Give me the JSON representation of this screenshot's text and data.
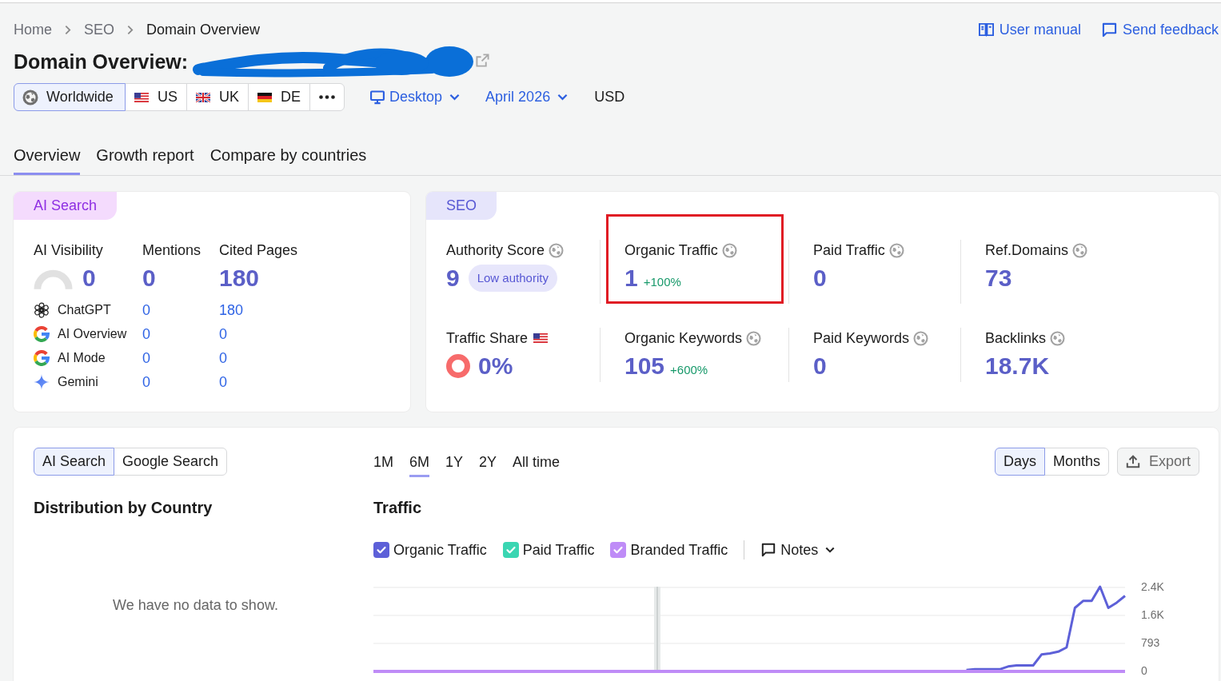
{
  "header": {
    "breadcrumbs": [
      {
        "label": "Home",
        "current": false
      },
      {
        "label": "SEO",
        "current": false
      },
      {
        "label": "Domain Overview",
        "current": true
      }
    ],
    "links": [
      {
        "label": "User manual",
        "kind": "manual"
      },
      {
        "label": "Send feedback",
        "kind": "feedback"
      }
    ],
    "title": "Domain Overview:",
    "domain_redacted": true,
    "databases": [
      {
        "label": "Worldwide",
        "kind": "globe",
        "selected": true
      },
      {
        "label": "US",
        "kind": "us",
        "selected": false
      },
      {
        "label": "UK",
        "kind": "uk",
        "selected": false
      },
      {
        "label": "DE",
        "kind": "de",
        "selected": false
      },
      {
        "kind": "more",
        "selected": false
      }
    ],
    "device": "Desktop",
    "date": "April 2026",
    "currency": "USD"
  },
  "tabs": [
    {
      "label": "Overview",
      "selected": true
    },
    {
      "label": "Growth report",
      "selected": false
    },
    {
      "label": "Compare by countries",
      "selected": false
    }
  ],
  "ai_search_card": {
    "tag": "AI Search",
    "metrics": [
      {
        "label": "AI Visibility",
        "value": "0",
        "kind": "gauge"
      },
      {
        "label": "Mentions",
        "value": "0",
        "kind": "plain"
      },
      {
        "label": "Cited Pages",
        "value": "180",
        "kind": "plain"
      }
    ],
    "platforms": [
      {
        "name": "ChatGPT",
        "kind": "chatgpt",
        "mentions": "0",
        "cited_pages": "180"
      },
      {
        "name": "AI Overview",
        "kind": "google",
        "mentions": "0",
        "cited_pages": "0"
      },
      {
        "name": "AI Mode",
        "kind": "google",
        "mentions": "0",
        "cited_pages": "0"
      },
      {
        "name": "Gemini",
        "kind": "gemini",
        "mentions": "0",
        "cited_pages": "0"
      }
    ]
  },
  "seo_card": {
    "tag": "SEO",
    "metrics": [
      {
        "label": "Authority Score",
        "label_icon": {
          "kind": "globe"
        },
        "value": "9",
        "kind": "badge",
        "badge": "Low authority",
        "highlighted": false
      },
      {
        "label": "Organic Traffic",
        "label_icon": {
          "kind": "globe"
        },
        "value": "1",
        "kind": "change",
        "change": "+100%",
        "highlighted": true
      },
      {
        "label": "Paid Traffic",
        "label_icon": {
          "kind": "globe"
        },
        "value": "0",
        "kind": "plain",
        "highlighted": false
      },
      {
        "label": "Ref.Domains",
        "label_icon": {
          "kind": "globe"
        },
        "value": "73",
        "kind": "plain",
        "highlighted": false
      },
      {
        "label": "Traffic Share",
        "label_icon": {
          "kind": "us_flag"
        },
        "value": "0%",
        "kind": "ring",
        "highlighted": false
      },
      {
        "label": "Organic Keywords",
        "label_icon": {
          "kind": "globe"
        },
        "value": "105",
        "kind": "change",
        "change": "+600%",
        "highlighted": false
      },
      {
        "label": "Paid Keywords",
        "label_icon": {
          "kind": "globe"
        },
        "value": "0",
        "kind": "plain",
        "highlighted": false
      },
      {
        "label": "Backlinks",
        "label_icon": {
          "kind": "globe"
        },
        "value": "18.7K",
        "kind": "plain",
        "highlighted": false
      }
    ]
  },
  "performance_card": {
    "source_toggle": [
      {
        "label": "AI Search",
        "selected": true
      },
      {
        "label": "Google Search",
        "selected": false
      }
    ],
    "distribution": {
      "title": "Distribution by Country",
      "empty_message": "We have no data to show."
    },
    "periods": [
      {
        "label": "1M",
        "selected": false
      },
      {
        "label": "6M",
        "selected": true
      },
      {
        "label": "1Y",
        "selected": false
      },
      {
        "label": "2Y",
        "selected": false
      },
      {
        "label": "All time",
        "selected": false
      }
    ],
    "granularity": [
      {
        "label": "Days",
        "selected": true
      },
      {
        "label": "Months",
        "selected": false
      }
    ],
    "export_button": "Export",
    "traffic": {
      "title": "Traffic",
      "legend": [
        {
          "checked": true
        },
        {
          "checked": true
        },
        {
          "checked": true
        }
      ],
      "notes": "Notes",
      "chart_data": {
        "type": "line",
        "categories": [
          null,
          null,
          null,
          null,
          null,
          null,
          null,
          null,
          null,
          null,
          null,
          null,
          null,
          null,
          null,
          null,
          null,
          null,
          null,
          null,
          null,
          null,
          null,
          null,
          null,
          null,
          null,
          null,
          null,
          null,
          null,
          null,
          null,
          null,
          null,
          null,
          null,
          null,
          null,
          null,
          null,
          null,
          null,
          null,
          null,
          null,
          null,
          null,
          null,
          null,
          null,
          null,
          null,
          null,
          null,
          null,
          null,
          null,
          null,
          null,
          null,
          null,
          null,
          null,
          null,
          null,
          null,
          null,
          null,
          null,
          null,
          null,
          null,
          null,
          null,
          null,
          null,
          null,
          null,
          null,
          null,
          null,
          null,
          null,
          null,
          null,
          null,
          null,
          null,
          null,
          null
        ],
        "ylim": [
          0,
          2400
        ],
        "yticks": [
          {
            "value": 0,
            "label": "0"
          },
          {
            "value": 793,
            "label": "793"
          },
          {
            "value": 1586,
            "label": "1.6K"
          },
          {
            "value": 2379,
            "label": "2.4K"
          }
        ],
        "series": [
          {
            "name": "Organic Traffic",
            "color": "#5d60d8",
            "values": [
              null,
              null,
              null,
              null,
              null,
              null,
              null,
              null,
              null,
              null,
              null,
              null,
              null,
              null,
              null,
              null,
              null,
              null,
              null,
              null,
              null,
              null,
              null,
              null,
              null,
              null,
              null,
              null,
              null,
              null,
              null,
              null,
              null,
              null,
              null,
              null,
              null,
              null,
              null,
              null,
              null,
              null,
              null,
              null,
              null,
              null,
              null,
              null,
              null,
              null,
              null,
              null,
              null,
              null,
              null,
              null,
              null,
              null,
              null,
              null,
              null,
              null,
              null,
              null,
              null,
              null,
              null,
              null,
              null,
              null,
              null,
              40,
              60,
              60,
              60,
              60,
              140,
              170,
              170,
              170,
              480,
              510,
              560,
              680,
              1800,
              2000,
              2000,
              2400,
              1800,
              1950,
              2140
            ]
          },
          {
            "name": "Paid Traffic",
            "color": "#3ad6b2",
            "values": [
              null,
              null,
              null,
              null,
              null,
              null,
              null,
              null,
              null,
              null,
              null,
              null,
              null,
              null,
              null,
              null,
              null,
              null,
              null,
              null,
              null,
              null,
              null,
              null,
              null,
              null,
              null,
              null,
              null,
              null,
              null,
              null,
              null,
              null,
              null,
              null,
              null,
              null,
              null,
              null,
              null,
              null,
              null,
              null,
              null,
              null,
              null,
              null,
              null,
              null,
              null,
              null,
              null,
              null,
              null,
              null,
              null,
              null,
              null,
              null,
              null,
              null,
              null,
              null,
              null,
              null,
              null,
              null,
              null,
              null,
              null,
              null,
              null,
              null,
              null,
              null,
              null,
              null,
              null,
              null,
              null,
              null,
              null,
              null,
              null,
              null,
              null,
              null,
              null,
              null,
              null
            ]
          },
          {
            "name": "Branded Traffic",
            "color": "#bf8cf7",
            "values": [
              0,
              0,
              0,
              0,
              0,
              0,
              0,
              0,
              0,
              0,
              0,
              0,
              0,
              0,
              0,
              0,
              0,
              0,
              0,
              0,
              0,
              0,
              0,
              0,
              0,
              0,
              0,
              0,
              0,
              0,
              0,
              0,
              0,
              0,
              0,
              0,
              0,
              0,
              0,
              0,
              0,
              0,
              0,
              0,
              0,
              0,
              0,
              0,
              0,
              0,
              0,
              0,
              0,
              0,
              0,
              0,
              0,
              0,
              0,
              0,
              0,
              0,
              0,
              0,
              0,
              0,
              0,
              0,
              0,
              0,
              0,
              0,
              0,
              0,
              0,
              0,
              0,
              0,
              0,
              0,
              0,
              0,
              0,
              0,
              0,
              0,
              0,
              0,
              0,
              0,
              0
            ]
          }
        ]
      }
    }
  }
}
